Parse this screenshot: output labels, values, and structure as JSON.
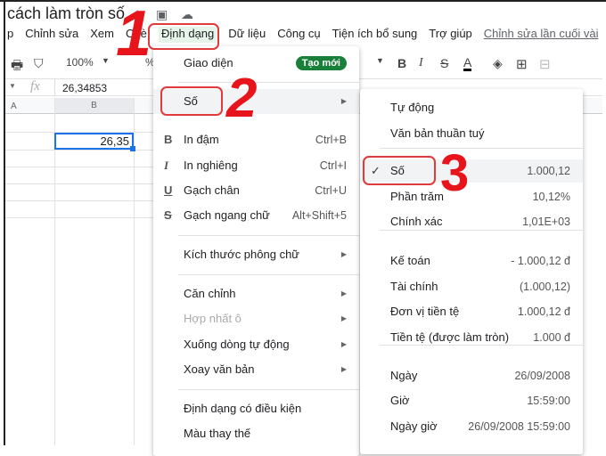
{
  "title": "cách làm tròn số",
  "title_icons": [
    "star-icon",
    "folder-move-icon",
    "cloud-status-icon"
  ],
  "menubar": [
    "p",
    "Chỉnh sửa",
    "Xem",
    "Chèn",
    "Định dạng",
    "Dữ liệu",
    "Công cụ",
    "Tiện ích bổ sung",
    "Trợ giúp"
  ],
  "last_edit": "Chỉnh sửa lần cuối vài",
  "toolbar": {
    "zoom": "100%",
    "font_more": "%"
  },
  "formula": {
    "fx": "fx",
    "value": "26,34853"
  },
  "columns": [
    "A",
    "B"
  ],
  "cell_b2": "26,35",
  "format_menu": {
    "giao_dien": "Giao diện",
    "badge": "Tạo mới",
    "so": "Số",
    "bold": {
      "label": "In đậm",
      "shortcut": "Ctrl+B",
      "icon": "B"
    },
    "italic": {
      "label": "In nghiêng",
      "shortcut": "Ctrl+I",
      "icon": "I"
    },
    "underline": {
      "label": "Gạch chân",
      "shortcut": "Ctrl+U",
      "icon": "U"
    },
    "strike": {
      "label": "Gạch ngang chữ",
      "shortcut": "Alt+Shift+5",
      "icon": "S"
    },
    "font_size": "Kích thước phông chữ",
    "align": "Căn chỉnh",
    "merge": "Hợp nhất ô",
    "wrap": "Xuống dòng tự động",
    "rotate": "Xoay văn bản",
    "conditional": "Định dạng có điều kiện",
    "alternate": "Màu thay thế"
  },
  "number_menu": [
    {
      "label": "Tự động",
      "value": ""
    },
    {
      "label": "Văn bản thuần tuý",
      "value": ""
    },
    {
      "label": "Số",
      "value": "1.000,12",
      "checked": true
    },
    {
      "label": "Phần trăm",
      "value": "10,12%"
    },
    {
      "label": "Chính xác",
      "value": "1,01E+03"
    },
    {
      "label": "Kế toán",
      "value": "- 1.000,12 đ"
    },
    {
      "label": "Tài chính",
      "value": "(1.000,12)"
    },
    {
      "label": "Đơn vị tiền tệ",
      "value": "1.000,12 đ"
    },
    {
      "label": "Tiền tệ (được làm tròn)",
      "value": "1.000 đ"
    },
    {
      "label": "Ngày",
      "value": "26/09/2008"
    },
    {
      "label": "Giờ",
      "value": "15:59:00"
    },
    {
      "label": "Ngày giờ",
      "value": "26/09/2008 15:59:00"
    }
  ],
  "annotations": [
    "1",
    "2",
    "3"
  ],
  "colors": {
    "accent": "#1a73e8",
    "annotation": "#e8141b",
    "badge": "#188038"
  }
}
